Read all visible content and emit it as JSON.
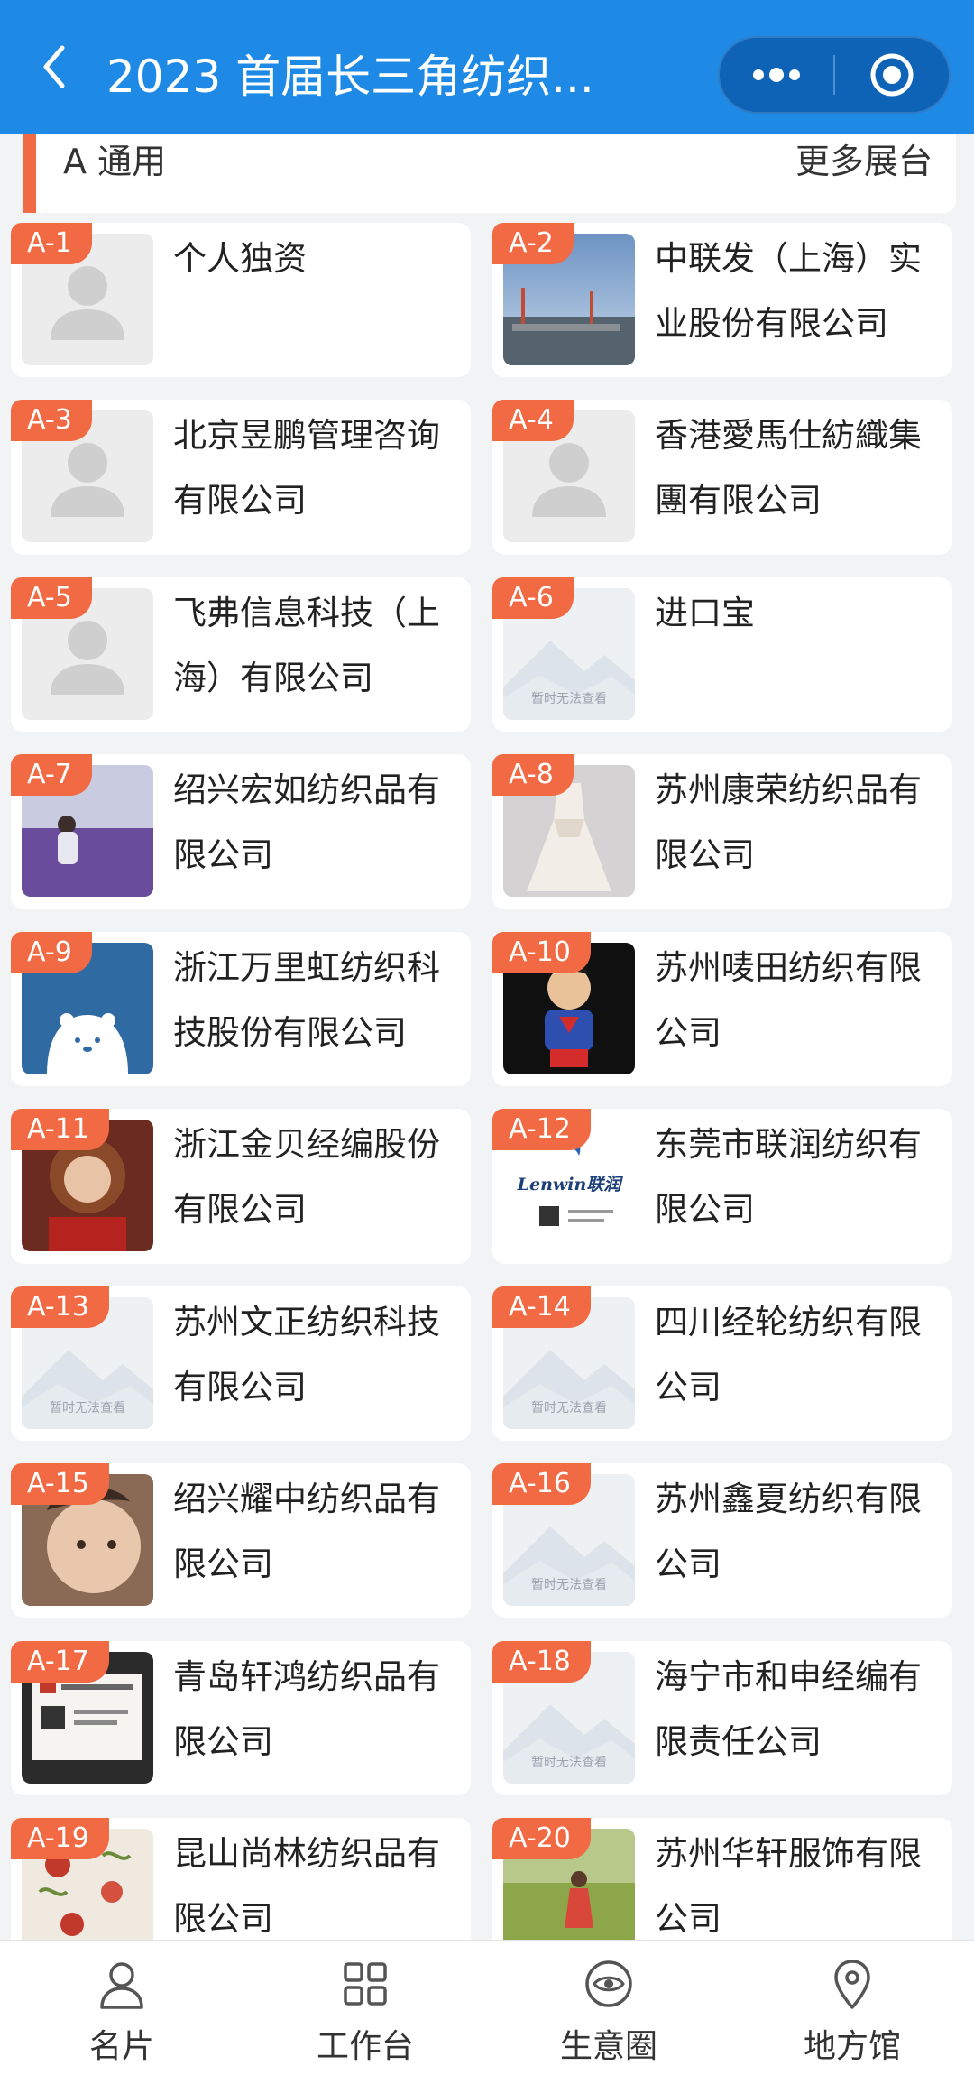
{
  "header": {
    "title": "2023 首届长三角纺织...",
    "back_icon": "chevron-left-icon",
    "menu_icon": "more-dots-icon",
    "target_icon": "target-icon"
  },
  "section": {
    "title": "A 通用",
    "more": "更多展台"
  },
  "exhibitors": [
    {
      "tag": "A-1",
      "name": "个人独资",
      "thumb": "avatar-placeholder"
    },
    {
      "tag": "A-2",
      "name": "中联发（上海）实业股份有限公司",
      "thumb": "photo-harbor"
    },
    {
      "tag": "A-3",
      "name": "北京昱鹏管理咨询有限公司",
      "thumb": "avatar-placeholder"
    },
    {
      "tag": "A-4",
      "name": "香港愛馬仕紡織集團有限公司",
      "thumb": "avatar-placeholder"
    },
    {
      "tag": "A-5",
      "name": "飞弗信息科技（上海）有限公司",
      "thumb": "avatar-placeholder"
    },
    {
      "tag": "A-6",
      "name": "进口宝",
      "thumb": "unavailable",
      "thumb_text": "暂时无法查看"
    },
    {
      "tag": "A-7",
      "name": "绍兴宏如纺织品有限公司",
      "thumb": "photo-lavender"
    },
    {
      "tag": "A-8",
      "name": "苏州康荣纺织品有限公司",
      "thumb": "photo-gown"
    },
    {
      "tag": "A-9",
      "name": "浙江万里虹纺织科技股份有限公司",
      "thumb": "bear-logo"
    },
    {
      "tag": "A-10",
      "name": "苏州唛田纺织有限公司",
      "thumb": "superman-figure"
    },
    {
      "tag": "A-11",
      "name": "浙江金贝经编股份有限公司",
      "thumb": "photo-girl-red"
    },
    {
      "tag": "A-12",
      "name": "东莞市联润纺织有限公司",
      "thumb": "lenwin-card",
      "thumb_text": "Lenwin联润"
    },
    {
      "tag": "A-13",
      "name": "苏州文正纺织科技有限公司",
      "thumb": "unavailable",
      "thumb_text": "暂时无法查看"
    },
    {
      "tag": "A-14",
      "name": "四川经轮纺织有限公司",
      "thumb": "unavailable",
      "thumb_text": "暂时无法查看"
    },
    {
      "tag": "A-15",
      "name": "绍兴耀中纺织品有限公司",
      "thumb": "photo-child"
    },
    {
      "tag": "A-16",
      "name": "苏州鑫夏纺织有限公司",
      "thumb": "unavailable",
      "thumb_text": "暂时无法查看"
    },
    {
      "tag": "A-17",
      "name": "青岛轩鸿纺织品有限公司",
      "thumb": "business-card"
    },
    {
      "tag": "A-18",
      "name": "海宁市和申经编有限责任公司",
      "thumb": "unavailable",
      "thumb_text": "暂时无法查看"
    },
    {
      "tag": "A-19",
      "name": "昆山尚林纺织品有限公司",
      "thumb": "floral-fabric"
    },
    {
      "tag": "A-20",
      "name": "苏州华轩服饰有限公司",
      "thumb": "photo-field"
    }
  ],
  "bottom_nav": [
    {
      "label": "名片",
      "icon": "person-icon"
    },
    {
      "label": "工作台",
      "icon": "grid-icon"
    },
    {
      "label": "生意圈",
      "icon": "eye-icon"
    },
    {
      "label": "地方馆",
      "icon": "location-pin-icon"
    }
  ],
  "colors": {
    "header": "#1e8ae6",
    "accent": "#f26a43",
    "background": "#f2f3f5"
  }
}
